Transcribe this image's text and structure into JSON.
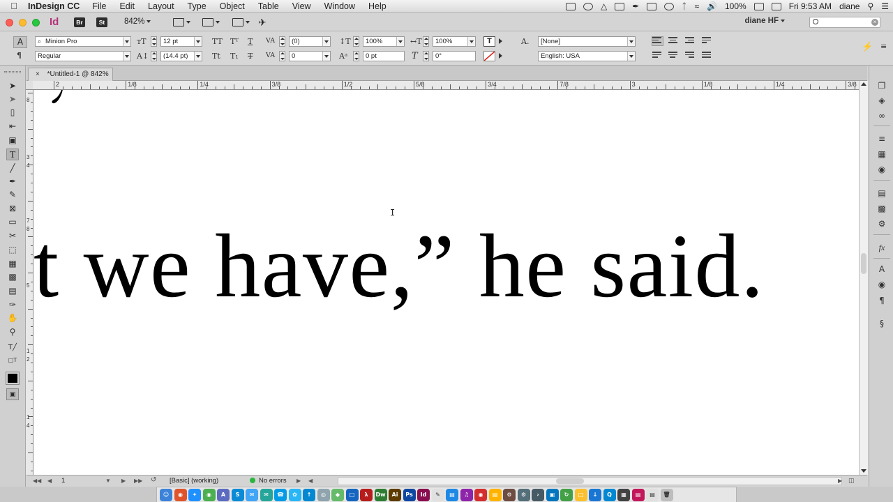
{
  "menubar": {
    "apple_icon": "apple-logo-icon",
    "app_name": "InDesign CC",
    "items": [
      "File",
      "Edit",
      "Layout",
      "Type",
      "Object",
      "Table",
      "View",
      "Window",
      "Help"
    ],
    "battery": "100%",
    "time": "Fri 9:53 AM",
    "user": "diane"
  },
  "appbar": {
    "logo": "Id",
    "bridge": "Br",
    "stock": "St",
    "zoom": "842%",
    "workspace": "diane HF"
  },
  "control": {
    "font_family": "Minion Pro",
    "font_style": "Regular",
    "font_size": "12 pt",
    "leading": "(14.4 pt)",
    "kerning": "(0)",
    "tracking": "0",
    "vertical_scale": "100%",
    "horizontal_scale": "100%",
    "baseline_shift": "0 pt",
    "skew": "0°",
    "char_style": "[None]",
    "language": "English: USA",
    "caps_labels": [
      "TT",
      "Tᵀ",
      "T",
      "Tt",
      "T₁",
      "T"
    ]
  },
  "document": {
    "tab_title": "*Untitled-1 @ 842%",
    "text": "t we have,” he said."
  },
  "hruler": {
    "labels": [
      "2",
      "1/8",
      "1/4",
      "3/8",
      "1/2",
      "5/8",
      "3/4",
      "7/8",
      "3",
      "1/8",
      "1/4",
      "3/8"
    ]
  },
  "vruler": {
    "labels": [
      "8",
      "3",
      "4",
      "7",
      "8",
      "5",
      "1",
      "2",
      "1",
      "4"
    ]
  },
  "statusbar": {
    "page": "1",
    "preflight_profile": "[Basic] (working)",
    "preflight_status": "No errors",
    "status_color": "#2bb63e"
  },
  "colors": {
    "accent": "#b3337a",
    "traffic_red": "#fc5f57",
    "traffic_yellow": "#fdbc2e",
    "traffic_green": "#28c840"
  }
}
